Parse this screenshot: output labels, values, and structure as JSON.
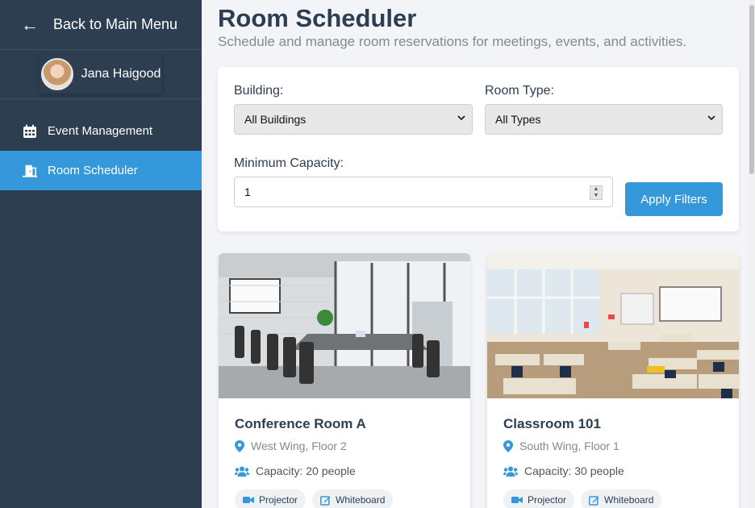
{
  "sidebar": {
    "back_label": "Back to Main Menu",
    "user_name": "Jana Haigood",
    "items": [
      {
        "label": "Event Management",
        "icon": "calendar-icon",
        "active": false
      },
      {
        "label": "Room Scheduler",
        "icon": "door-icon",
        "active": true
      }
    ]
  },
  "header": {
    "title": "Room Scheduler",
    "subtitle": "Schedule and manage room reservations for meetings, events, and activities."
  },
  "filters": {
    "building_label": "Building:",
    "building_value": "All Buildings",
    "room_type_label": "Room Type:",
    "room_type_value": "All Types",
    "capacity_label": "Minimum Capacity:",
    "capacity_value": "1",
    "apply_label": "Apply Filters"
  },
  "rooms": [
    {
      "name": "Conference Room A",
      "location": "West Wing, Floor 2",
      "capacity": "Capacity: 20 people",
      "amenities": [
        "Projector",
        "Whiteboard"
      ]
    },
    {
      "name": "Classroom 101",
      "location": "South Wing, Floor 1",
      "capacity": "Capacity: 30 people",
      "amenities": [
        "Projector",
        "Whiteboard"
      ]
    }
  ],
  "colors": {
    "sidebar_bg": "#2c3e50",
    "accent": "#3498db",
    "page_bg": "#f2f4f7"
  }
}
